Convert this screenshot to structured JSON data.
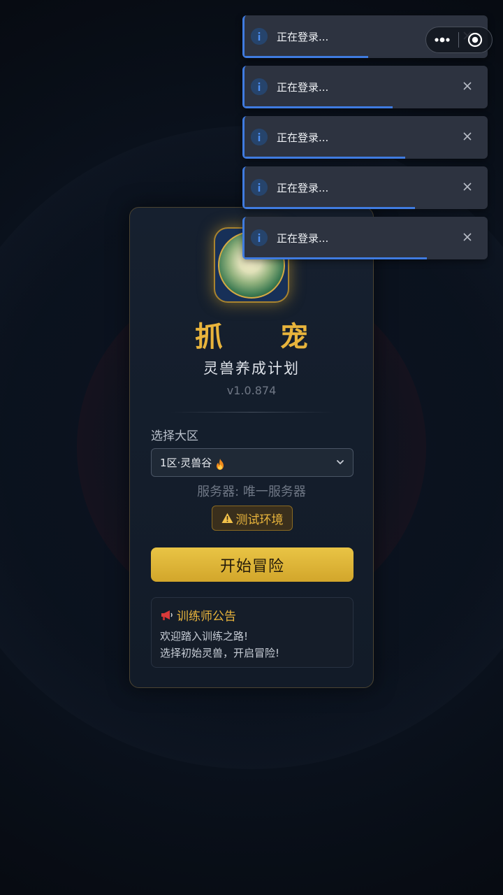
{
  "app": {
    "title": "抓 宠",
    "subtitle": "灵兽养成计划",
    "version": "v1.0.874"
  },
  "region": {
    "label": "选择大区",
    "selected": "1区·灵兽谷",
    "selected_icon": "fire-icon"
  },
  "server": {
    "text": "服务器: 唯一服务器"
  },
  "env_badge": {
    "text": "测试环境",
    "icon": "warning-icon",
    "color": "#e8b43c"
  },
  "start_button": {
    "label": "开始冒险",
    "color": "#d9b033"
  },
  "notice": {
    "title": "训练师公告",
    "icon": "megaphone-icon",
    "lines": [
      "欢迎踏入训练之路!",
      "选择初始灵兽，开启冒险!"
    ]
  },
  "toasts": [
    {
      "message": "正在登录...",
      "icon": "info-icon",
      "progress": 0.51
    },
    {
      "message": "正在登录...",
      "icon": "info-icon",
      "progress": 0.61
    },
    {
      "message": "正在登录...",
      "icon": "info-icon",
      "progress": 0.66
    },
    {
      "message": "正在登录...",
      "icon": "info-icon",
      "progress": 0.7
    },
    {
      "message": "正在登录...",
      "icon": "info-icon",
      "progress": 0.75
    }
  ],
  "capsule": {
    "more_icon": "more-dots-icon",
    "close_icon": "target-icon"
  },
  "colors": {
    "accent_gold": "#e8b43c",
    "info_blue": "#3f7be0",
    "background": "#070c14"
  }
}
